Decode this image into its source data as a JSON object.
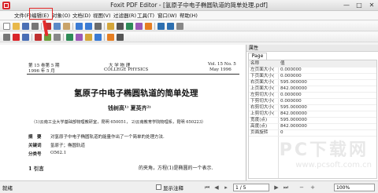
{
  "window": {
    "title": "Foxit PDF Editor - [氢原子中电子椭圆轨道的简单处理.pdf]",
    "minimize": "—",
    "maximize": "□",
    "close": "✕"
  },
  "menu": [
    {
      "label": "文件(F)"
    },
    {
      "label": "编辑(E)"
    },
    {
      "label": "对象(O)"
    },
    {
      "label": "文档(D)"
    },
    {
      "label": "视图(V)"
    },
    {
      "label": "过滤器(R)"
    },
    {
      "label": "工具(T)"
    },
    {
      "label": "窗口(W)"
    },
    {
      "label": "帮助(H)"
    }
  ],
  "toolbar_icons": [
    "new-file",
    "open-folder",
    "save",
    "print",
    "cut",
    "copy",
    "paste",
    "undo",
    "redo",
    "find",
    "properties",
    "hand-tool",
    "select-tool",
    "text-tool",
    "image-tool",
    "line-tool",
    "zoom-in",
    "zoom-out"
  ],
  "document": {
    "header_left_1": "第 15 卷第 5 期",
    "header_left_2": "1996 年   5 月",
    "header_center_1": "大  学  物  理",
    "header_center_2": "COLLEGE  PHYSICS",
    "header_right_1": "Vol. 15 No. 5",
    "header_right_2": "May 1996",
    "title": "氢原子中电子椭圆轨道的简单处理",
    "authors": "钱树高¹⁾   夏英齐²⁾",
    "affiliation": "（1)云南工业大学基础部物理教研室，昆明  650051，  2)云南教育学院物理系，昆明  650223）",
    "abstract_label": "摘　要",
    "abstract_text": "对氢原子中电子椭圆轨道的能量作出了一个简单的处理方法.",
    "keywords_label": "关键词",
    "keywords_text": "氢原子；椭圆轨道",
    "class_label": "分类号",
    "class_text": "O562.1",
    "section": "1  引言",
    "body_fragment": "的夹角，方程(1)是椭圆的一个表示."
  },
  "panel": {
    "title": "属性",
    "tab": "Page",
    "col_name": "名称",
    "col_value": "值",
    "rows": [
      {
        "name": "左页面大小(",
        "value": "0.000000"
      },
      {
        "name": "下页面大小(",
        "value": "0.000000"
      },
      {
        "name": "右页面大小(",
        "value": "595.000000"
      },
      {
        "name": "上页面大小(",
        "value": "842.000000"
      },
      {
        "name": "左剪切大小(",
        "value": "0.000000"
      },
      {
        "name": "下剪切大小(",
        "value": "0.000000"
      },
      {
        "name": "右剪切大小(",
        "value": "595.000000"
      },
      {
        "name": "上剪切大小(",
        "value": "842.000000"
      },
      {
        "name": "宽度(点)",
        "value": "595.000000"
      },
      {
        "name": "高度(点)",
        "value": "842.000000"
      },
      {
        "name": "页面旋转",
        "value": "0"
      }
    ]
  },
  "status": {
    "text": "就绪",
    "checkbox_label": "显示注释",
    "page_display": "1 / 5",
    "zoom_display": "100%"
  },
  "watermark": {
    "text": "PC下载网",
    "url": "www.pcsoft.com.cn"
  },
  "colors": {
    "highlight": "#e52b2b",
    "brand": "#d9262b"
  }
}
